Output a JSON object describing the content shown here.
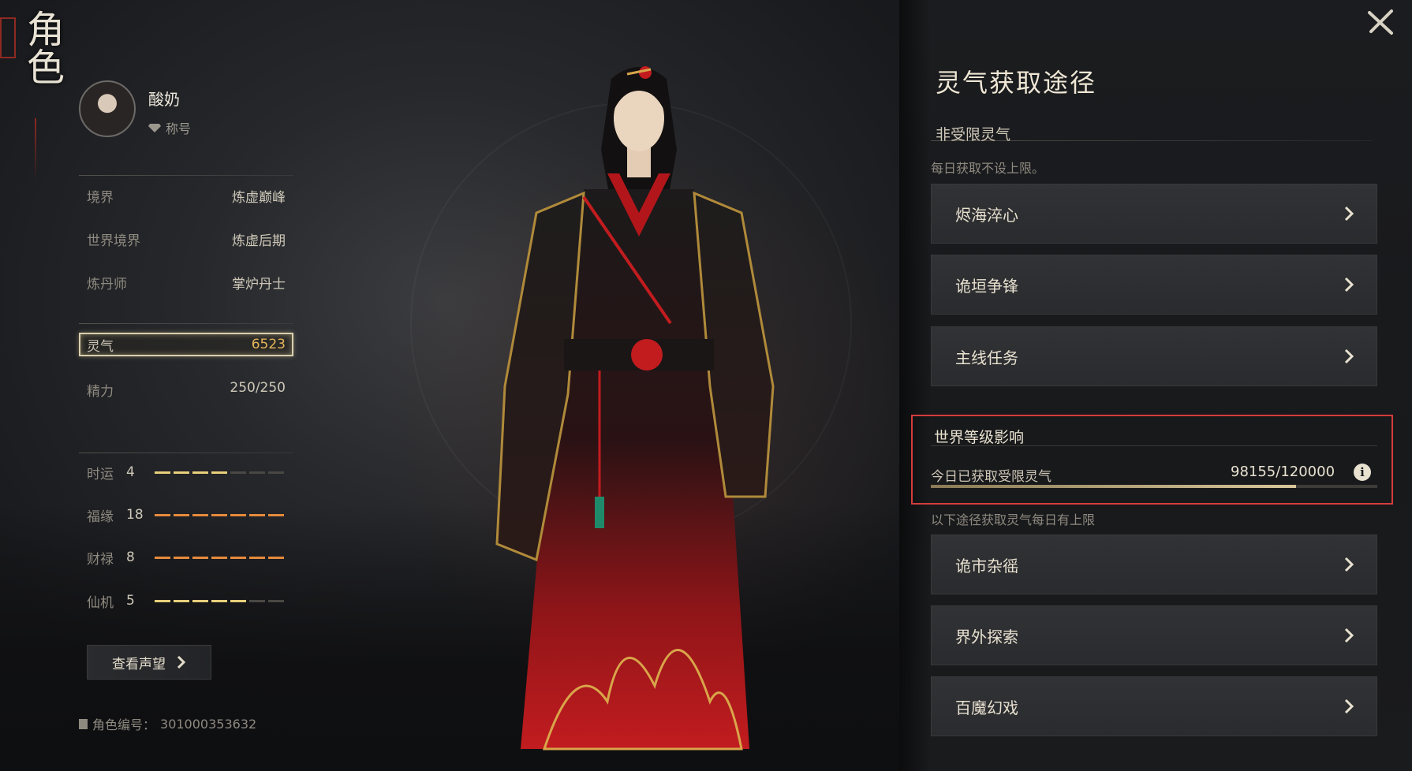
{
  "side_title": "角色",
  "profile": {
    "name": "酸奶",
    "title": "称号"
  },
  "stats": [
    {
      "key": "境界",
      "value": "炼虚巅峰"
    },
    {
      "key": "世界境界",
      "value": "炼虚后期"
    },
    {
      "key": "炼丹师",
      "value": "掌炉丹士"
    }
  ],
  "lingqi": {
    "key": "灵气",
    "value": "6523"
  },
  "energy": {
    "key": "精力",
    "value": "250/250"
  },
  "luck": [
    {
      "key": "时运",
      "value": "4",
      "level": 4,
      "color": "#e7cf7a"
    },
    {
      "key": "福缘",
      "value": "18",
      "level": 7,
      "color": "#e58a3c"
    },
    {
      "key": "财禄",
      "value": "8",
      "level": 7,
      "color": "#e58a3c"
    },
    {
      "key": "仙机",
      "value": "5",
      "level": 5,
      "color": "#e7cf7a"
    }
  ],
  "luck_max_segments": 7,
  "reputation_button": "查看声望",
  "char_id": {
    "label": "角色编号：",
    "value": "301000353632"
  },
  "panel": {
    "title": "灵气获取途径",
    "unlimited_section": "非受限灵气",
    "unlimited_note": "每日获取不设上限。",
    "unlimited_routes": [
      "烬海淬心",
      "诡垣争锋",
      "主线任务"
    ],
    "world_section": "世界等级影响",
    "world_label": "今日已获取受限灵气",
    "world_value": "98155/120000",
    "world_progress": 0.818,
    "info_icon": "i",
    "limited_note": "以下途径获取灵气每日有上限",
    "limited_routes": [
      "诡市杂徭",
      "界外探索",
      "百魔幻戏"
    ]
  }
}
